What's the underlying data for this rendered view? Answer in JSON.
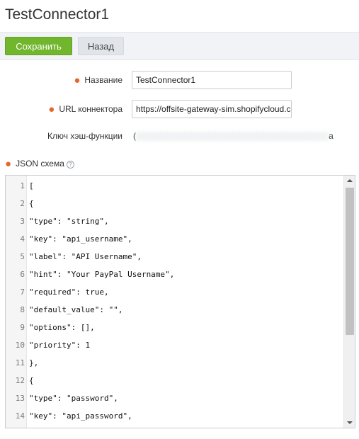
{
  "page": {
    "title": "TestConnector1"
  },
  "toolbar": {
    "save_label": "Сохранить",
    "back_label": "Назад"
  },
  "form": {
    "name_label": "Название",
    "name_value": "TestConnector1",
    "url_label": "URL коннектора",
    "url_value": "https://offsite-gateway-sim.shopifycloud.com",
    "hash_label": "Ключ хэш-функции",
    "hash_value_visible_prefix": "(",
    "hash_value_visible_suffix": "a",
    "json_label": "JSON схема",
    "required_marker_color": "#e8662b"
  },
  "editor": {
    "lines": [
      {
        "n": "1",
        "code": "["
      },
      {
        "n": "2",
        "code": "{"
      },
      {
        "n": "3",
        "code": "\"type\": \"string\","
      },
      {
        "n": "4",
        "code": "\"key\": \"api_username\","
      },
      {
        "n": "5",
        "code": "\"label\": \"API Username\","
      },
      {
        "n": "6",
        "code": "\"hint\": \"Your PayPal Username\","
      },
      {
        "n": "7",
        "code": "\"required\": true,"
      },
      {
        "n": "8",
        "code": "\"default_value\": \"\","
      },
      {
        "n": "9",
        "code": "\"options\": [],"
      },
      {
        "n": "10",
        "code": "\"priority\": 1"
      },
      {
        "n": "11",
        "code": "},"
      },
      {
        "n": "12",
        "code": "{"
      },
      {
        "n": "13",
        "code": "\"type\": \"password\","
      },
      {
        "n": "14",
        "code": "\"key\": \"api_password\","
      }
    ]
  },
  "icons": {
    "help": "question-circle-icon"
  },
  "colors": {
    "save_button": "#71b62c",
    "accent_required": "#e8662b"
  }
}
